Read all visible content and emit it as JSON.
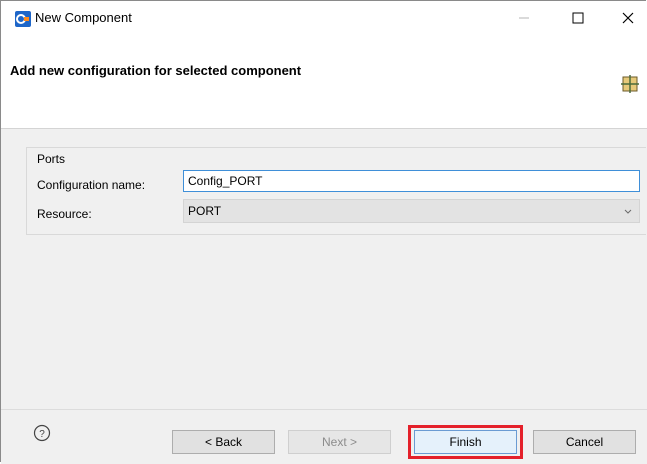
{
  "window": {
    "title": "New Component",
    "controls": {
      "minimize": "—",
      "maximize": "☐",
      "close": "✕"
    }
  },
  "header": {
    "title": "Add new configuration for selected component",
    "icon": "component-grid-icon"
  },
  "form": {
    "group_label": "Ports",
    "config_name_label": "Configuration name:",
    "config_name_value": "Config_PORT",
    "resource_label": "Resource:",
    "resource_value": "PORT"
  },
  "footer": {
    "help_icon": "help-icon",
    "back_label": "< Back",
    "next_label": "Next >",
    "finish_label": "Finish",
    "cancel_label": "Cancel"
  },
  "colors": {
    "accent_blue": "#1e66c8",
    "highlight_red": "#e4202a",
    "panel_gray": "#f0f0f0"
  }
}
